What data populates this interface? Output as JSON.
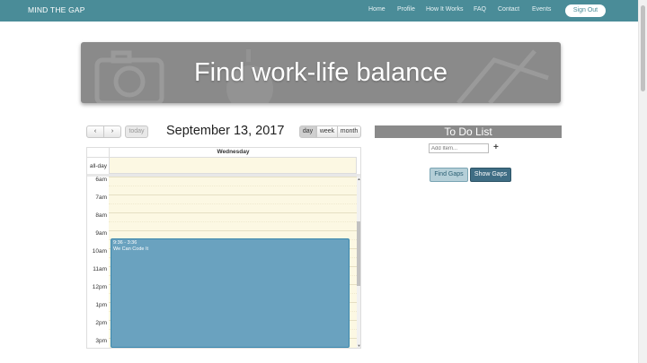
{
  "nav": {
    "brand": "MIND THE GAP",
    "links": [
      "Home",
      "Profile",
      "How It Works",
      "FAQ",
      "Contact",
      "Events"
    ],
    "signout": "Sign Out"
  },
  "banner": {
    "title": "Find work-life balance"
  },
  "calendar": {
    "prev_icon": "‹",
    "next_icon": "›",
    "today_label": "today",
    "title": "September 13, 2017",
    "views": [
      "day",
      "week",
      "month"
    ],
    "active_view": "day",
    "day_header": "Wednesday",
    "allday_label": "all-day",
    "hours": [
      "6am",
      "7am",
      "8am",
      "9am",
      "10am",
      "11am",
      "12pm",
      "1pm",
      "2pm",
      "3pm"
    ],
    "event": {
      "time": "9:36 - 3:36",
      "title": "We Can Code It"
    }
  },
  "todo": {
    "title": "To Do List",
    "placeholder": "Add Item...",
    "add_icon": "+",
    "find_gaps": "Find Gaps",
    "show_gaps": "Show Gaps"
  },
  "icons": {
    "camera": "camera-icon",
    "apple": "apple-icon",
    "pencil": "pencil-icon",
    "plus": "plus-icon"
  },
  "colors": {
    "navbar": "#4a8c98",
    "banner": "#8a8a8a",
    "event": "#6aa2bf",
    "slot_background": "#fcf8e3"
  }
}
